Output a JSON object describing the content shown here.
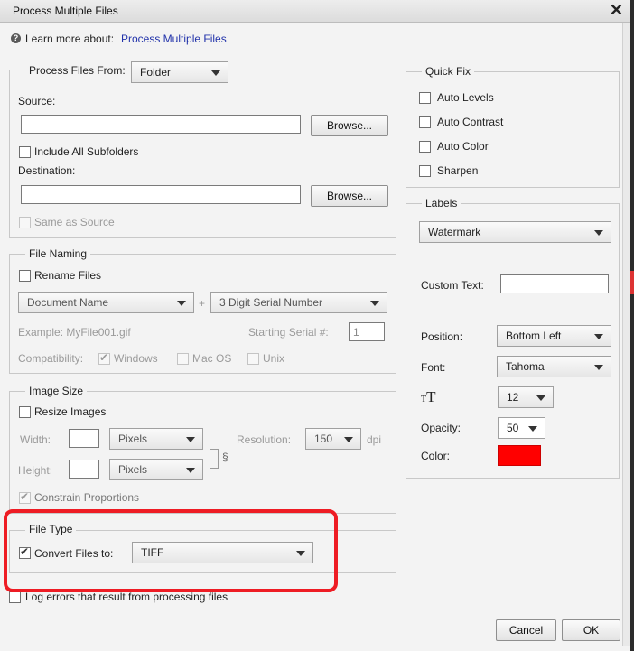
{
  "window": {
    "title": "Process Multiple Files"
  },
  "help": {
    "prefix": "Learn more about:",
    "link": "Process Multiple Files"
  },
  "process_from": {
    "label": "Process Files From:",
    "selected": "Folder",
    "source_label": "Source:",
    "source_value": "",
    "browse_label": "Browse...",
    "include_subfolders_label": "Include All Subfolders",
    "include_subfolders_checked": false,
    "destination_label": "Destination:",
    "destination_value": "",
    "same_as_source_label": "Same as Source",
    "same_as_source_checked": false
  },
  "file_naming": {
    "title": "File Naming",
    "rename_label": "Rename Files",
    "rename_checked": false,
    "name_select": "Document Name",
    "plus": "+",
    "serial_select": "3 Digit Serial Number",
    "example_label": "Example: MyFile001.gif",
    "starting_serial_label": "Starting Serial #:",
    "starting_serial_value": "1",
    "compatibility_label": "Compatibility:",
    "windows_label": "Windows",
    "windows_checked": true,
    "macos_label": "Mac OS",
    "macos_checked": false,
    "unix_label": "Unix",
    "unix_checked": false
  },
  "image_size": {
    "title": "Image Size",
    "resize_label": "Resize Images",
    "resize_checked": false,
    "width_label": "Width:",
    "width_value": "",
    "width_unit": "Pixels",
    "height_label": "Height:",
    "height_value": "",
    "height_unit": "Pixels",
    "resolution_label": "Resolution:",
    "resolution_value": "150",
    "resolution_unit": "dpi",
    "constrain_label": "Constrain Proportions",
    "constrain_checked": true
  },
  "file_type": {
    "title": "File Type",
    "convert_label": "Convert Files to:",
    "convert_checked": true,
    "format": "TIFF"
  },
  "log_errors": {
    "label": "Log errors that result from processing files",
    "checked": false
  },
  "quick_fix": {
    "title": "Quick Fix",
    "items": [
      {
        "label": "Auto Levels",
        "checked": false
      },
      {
        "label": "Auto Contrast",
        "checked": false
      },
      {
        "label": "Auto Color",
        "checked": false
      },
      {
        "label": "Sharpen",
        "checked": false
      }
    ]
  },
  "labels": {
    "title": "Labels",
    "type_select": "Watermark",
    "custom_text_label": "Custom Text:",
    "custom_text_value": "",
    "position_label": "Position:",
    "position_value": "Bottom Left",
    "font_label": "Font:",
    "font_value": "Tahoma",
    "size_icon_label": "T",
    "size_value": "12",
    "opacity_label": "Opacity:",
    "opacity_value": "50",
    "color_label": "Color:",
    "color_value": "#ff0000"
  },
  "footer": {
    "cancel_label": "Cancel",
    "ok_label": "OK"
  },
  "annotation_color": "#ee1c24"
}
